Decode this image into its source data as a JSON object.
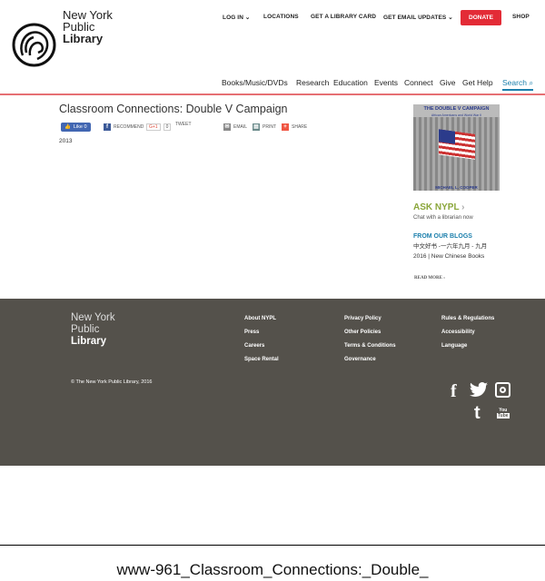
{
  "header": {
    "logo": {
      "line1": "New York",
      "line2": "Public",
      "line3": "Library"
    },
    "utility": [
      {
        "label": "LOG IN",
        "dropdown": true
      },
      {
        "label": "LOCATIONS"
      },
      {
        "label": "GET A LIBRARY CARD"
      },
      {
        "label": "GET EMAIL UPDATES",
        "dropdown": true
      },
      {
        "label": "DONATE"
      },
      {
        "label": "SHOP"
      }
    ],
    "nav": [
      "Books/Music/DVDs",
      "Research",
      "Education",
      "Events",
      "Connect",
      "Give",
      "Get Help"
    ],
    "search": "Search",
    "colors": {
      "accent": "#e32b36",
      "link": "#1b7fac",
      "rule": "#e66f73"
    }
  },
  "article": {
    "title": "Classroom Connections: Double V Campaign",
    "like": "Like 0",
    "recommend": "RECOMMEND",
    "gplus": "G+1",
    "gcount": "0",
    "tweet": "TWEET",
    "email": "EMAIL",
    "print": "PRINT",
    "share": "SHARE",
    "year": "2013"
  },
  "sidebar": {
    "book": {
      "title": "THE DOUBLE V CAMPAIGN",
      "subtitle": "African Americans and World War II",
      "author": "MICHAEL L. COOPER"
    },
    "ask": {
      "label": "ASK NYPL",
      "sub": "Chat with a librarian now"
    },
    "blogs": {
      "heading": "FROM OUR BLOGS",
      "post": "中文好书 -一六年九月 - 九月 2016 | New Chinese Books",
      "more": "READ MORE ›"
    }
  },
  "footer": {
    "logo": {
      "line1": "New York",
      "line2": "Public",
      "line3": "Library"
    },
    "col1": [
      "About NYPL",
      "Press",
      "Careers",
      "Space Rental"
    ],
    "col2": [
      "Privacy Policy",
      "Other Policies",
      "Terms & Conditions",
      "Governance"
    ],
    "col3": [
      "Rules & Regulations",
      "Accessibility",
      "Language"
    ],
    "copyright": "© The New York Public Library, 2016",
    "social": [
      "facebook-icon",
      "twitter-icon",
      "instagram-icon",
      "tumblr-icon",
      "youtube-icon"
    ],
    "bg": "#54514b"
  },
  "caption": "www-961_Classroom_Connections:_Double_"
}
